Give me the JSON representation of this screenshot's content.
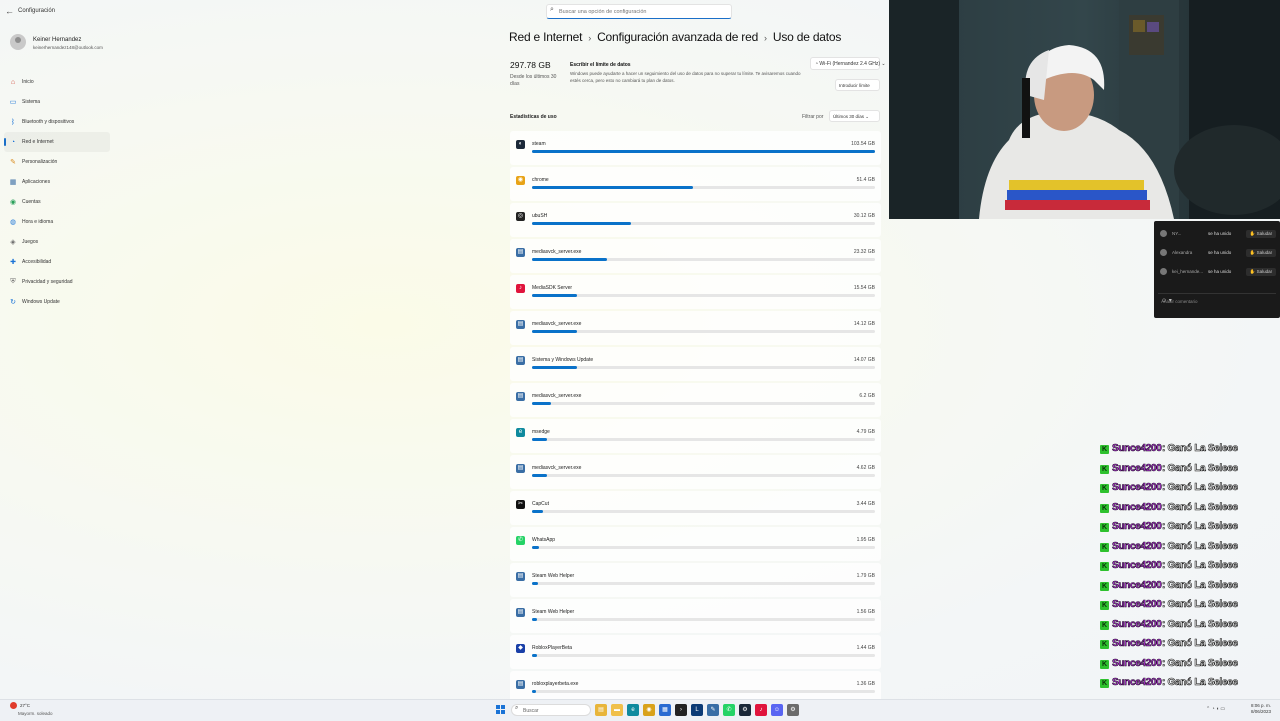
{
  "window": {
    "title": "Configuración"
  },
  "search": {
    "placeholder": "Buscar una opción de configuración"
  },
  "profile": {
    "name": "Keiner Hernandez",
    "email": "keinerhernandez148@outlook.com"
  },
  "nav": {
    "items": [
      {
        "label": "Inicio",
        "icon": "home-icon"
      },
      {
        "label": "Sistema",
        "icon": "monitor-icon"
      },
      {
        "label": "Bluetooth y dispositivos",
        "icon": "bluetooth-icon"
      },
      {
        "label": "Red e Internet",
        "icon": "wifi-icon",
        "active": true
      },
      {
        "label": "Personalización",
        "icon": "brush-icon"
      },
      {
        "label": "Aplicaciones",
        "icon": "apps-icon"
      },
      {
        "label": "Cuentas",
        "icon": "person-icon"
      },
      {
        "label": "Hora e idioma",
        "icon": "globe-icon"
      },
      {
        "label": "Juegos",
        "icon": "gamepad-icon"
      },
      {
        "label": "Accesibilidad",
        "icon": "accessibility-icon"
      },
      {
        "label": "Privacidad y seguridad",
        "icon": "shield-icon"
      },
      {
        "label": "Windows Update",
        "icon": "update-icon"
      }
    ]
  },
  "breadcrumb": {
    "level1": "Red e Internet",
    "level2": "Configuración avanzada de red",
    "level3": "Uso de datos"
  },
  "summary": {
    "total": "297.78 GB",
    "since": "Desde los últimos 30 días",
    "limit_title": "Escribir el límite de datos",
    "limit_desc": "Windows puede ayudarte a hacer un seguimiento del uso de datos para no superar tu límite. Te avisaremos cuando estés cerca, pero esto no cambiará tu plan de datos.",
    "network": "Wi-Fi (Hernandez 2.4 GHz)",
    "limit_button": "Introducir límite"
  },
  "stats": {
    "title": "Estadísticas de uso",
    "filter_label": "Filtrar por",
    "filter_value": "Últimos 30 días"
  },
  "apps": [
    {
      "name": "steam",
      "size": "103.54 GB",
      "fraction": 1.0,
      "icon": "steam-icon",
      "color": "#1b2838"
    },
    {
      "name": "chrome",
      "size": "51.4 GB",
      "fraction": 0.47,
      "icon": "chrome-icon",
      "color": "#e8a317"
    },
    {
      "name": "ubuSH",
      "size": "30.12 GB",
      "fraction": 0.29,
      "icon": "ubisoft-icon",
      "color": "#222222"
    },
    {
      "name": "mediasvck_server.exe",
      "size": "23.32 GB",
      "fraction": 0.22,
      "icon": "generic-app-icon",
      "color": "#3a6ea5"
    },
    {
      "name": "MediaSDK Server",
      "size": "15.54 GB",
      "fraction": 0.13,
      "icon": "tiktok-icon",
      "color": "#e0143c"
    },
    {
      "name": "mediasvck_server.exe",
      "size": "14.12 GB",
      "fraction": 0.13,
      "icon": "generic-app-icon",
      "color": "#3a6ea5"
    },
    {
      "name": "Sistema y Windows Update",
      "size": "14.07 GB",
      "fraction": 0.13,
      "icon": "windows-update-icon",
      "color": "#3a6ea5"
    },
    {
      "name": "mediasvck_server.exe",
      "size": "6.2 GB",
      "fraction": 0.055,
      "icon": "generic-app-icon",
      "color": "#3a6ea5"
    },
    {
      "name": "msedge",
      "size": "4.79 GB",
      "fraction": 0.045,
      "icon": "edge-icon",
      "color": "#0f8a9e"
    },
    {
      "name": "mediasvck_server.exe",
      "size": "4.62 GB",
      "fraction": 0.045,
      "icon": "generic-app-icon",
      "color": "#3a6ea5"
    },
    {
      "name": "CapCut",
      "size": "3.44 GB",
      "fraction": 0.033,
      "icon": "capcut-icon",
      "color": "#111111"
    },
    {
      "name": "WhatsApp",
      "size": "1.95 GB",
      "fraction": 0.019,
      "icon": "whatsapp-icon",
      "color": "#25d366"
    },
    {
      "name": "Steam Web Helper",
      "size": "1.79 GB",
      "fraction": 0.017,
      "icon": "generic-app-icon",
      "color": "#3a6ea5"
    },
    {
      "name": "Steam Web Helper",
      "size": "1.56 GB",
      "fraction": 0.015,
      "icon": "generic-app-icon",
      "color": "#3a6ea5"
    },
    {
      "name": "RobloxPlayerBeta",
      "size": "1.44 GB",
      "fraction": 0.014,
      "icon": "roblox-icon",
      "color": "#1a3fa8"
    },
    {
      "name": "robloxplayerbeta.exe",
      "size": "1.36 GB",
      "fraction": 0.013,
      "icon": "generic-app-icon",
      "color": "#3a6ea5"
    }
  ],
  "chat": {
    "messages": [
      {
        "user": "NY...",
        "msg": "se ha unido",
        "action": "Saludar"
      },
      {
        "user": "Alexandra",
        "msg": "se ha unido",
        "action": "Saludar"
      },
      {
        "user": "kei_hernande...",
        "msg": "se ha unido",
        "action": "Saludar"
      }
    ],
    "input_placeholder": "Añadir comentario"
  },
  "feed": {
    "entries": [
      {
        "badge": "K",
        "user": "Sunce4200",
        "msg": ": Ganó La Seleee"
      },
      {
        "badge": "K",
        "user": "Sunce4200",
        "msg": ": Ganó La Seleee"
      },
      {
        "badge": "K",
        "user": "Sunce4200",
        "msg": ": Ganó La Seleee"
      },
      {
        "badge": "K",
        "user": "Sunce4200",
        "msg": ": Ganó La Seleee"
      },
      {
        "badge": "K",
        "user": "Sunce4200",
        "msg": ": Ganó La Seleee"
      },
      {
        "badge": "K",
        "user": "Sunce4200",
        "msg": ": Ganó La Seleee"
      },
      {
        "badge": "K",
        "user": "Sunce4200",
        "msg": ": Ganó La Seleee"
      },
      {
        "badge": "K",
        "user": "Sunce4200",
        "msg": ": Ganó La Seleee"
      },
      {
        "badge": "K",
        "user": "Sunce4200",
        "msg": ": Ganó La Seleee"
      },
      {
        "badge": "K",
        "user": "Sunce4200",
        "msg": ": Ganó La Seleee"
      },
      {
        "badge": "K",
        "user": "Sunce4200",
        "msg": ": Ganó La Seleee"
      },
      {
        "badge": "K",
        "user": "Sunce4200",
        "msg": ": Ganó La Seleee"
      },
      {
        "badge": "K",
        "user": "Sunce4200",
        "msg": ": Ganó La Seleee"
      }
    ]
  },
  "taskbar": {
    "weather_temp": "27°C",
    "weather_desc": "Mayorm. soleado",
    "search_label": "Buscar",
    "time": "8:06 p. m.",
    "date": "8/06/2023",
    "apps": [
      {
        "icon": "file-explorer-icon",
        "color": "#e8b53a",
        "glyph": "▤"
      },
      {
        "icon": "folder-icon",
        "color": "#f0c04a",
        "glyph": "▬"
      },
      {
        "icon": "edge-icon",
        "color": "#0f8a9e",
        "glyph": "e"
      },
      {
        "icon": "chrome-icon",
        "color": "#d9a21b",
        "glyph": "◉"
      },
      {
        "icon": "store-icon",
        "color": "#2a6bd1",
        "glyph": "▦"
      },
      {
        "icon": "terminal-icon",
        "color": "#222222",
        "glyph": "›"
      },
      {
        "icon": "lightroom-icon",
        "color": "#0b3a75",
        "glyph": "L"
      },
      {
        "icon": "pen-icon",
        "color": "#3a6ea5",
        "glyph": "✎"
      },
      {
        "icon": "whatsapp-icon",
        "color": "#25d366",
        "glyph": "✆"
      },
      {
        "icon": "steam-icon",
        "color": "#1b2838",
        "glyph": "⚙"
      },
      {
        "icon": "tiktok-icon",
        "color": "#e0143c",
        "glyph": "♪"
      },
      {
        "icon": "discord-icon",
        "color": "#5865f2",
        "glyph": "☺"
      },
      {
        "icon": "settings-icon",
        "color": "#6b6b6b",
        "glyph": "⚙"
      }
    ]
  }
}
